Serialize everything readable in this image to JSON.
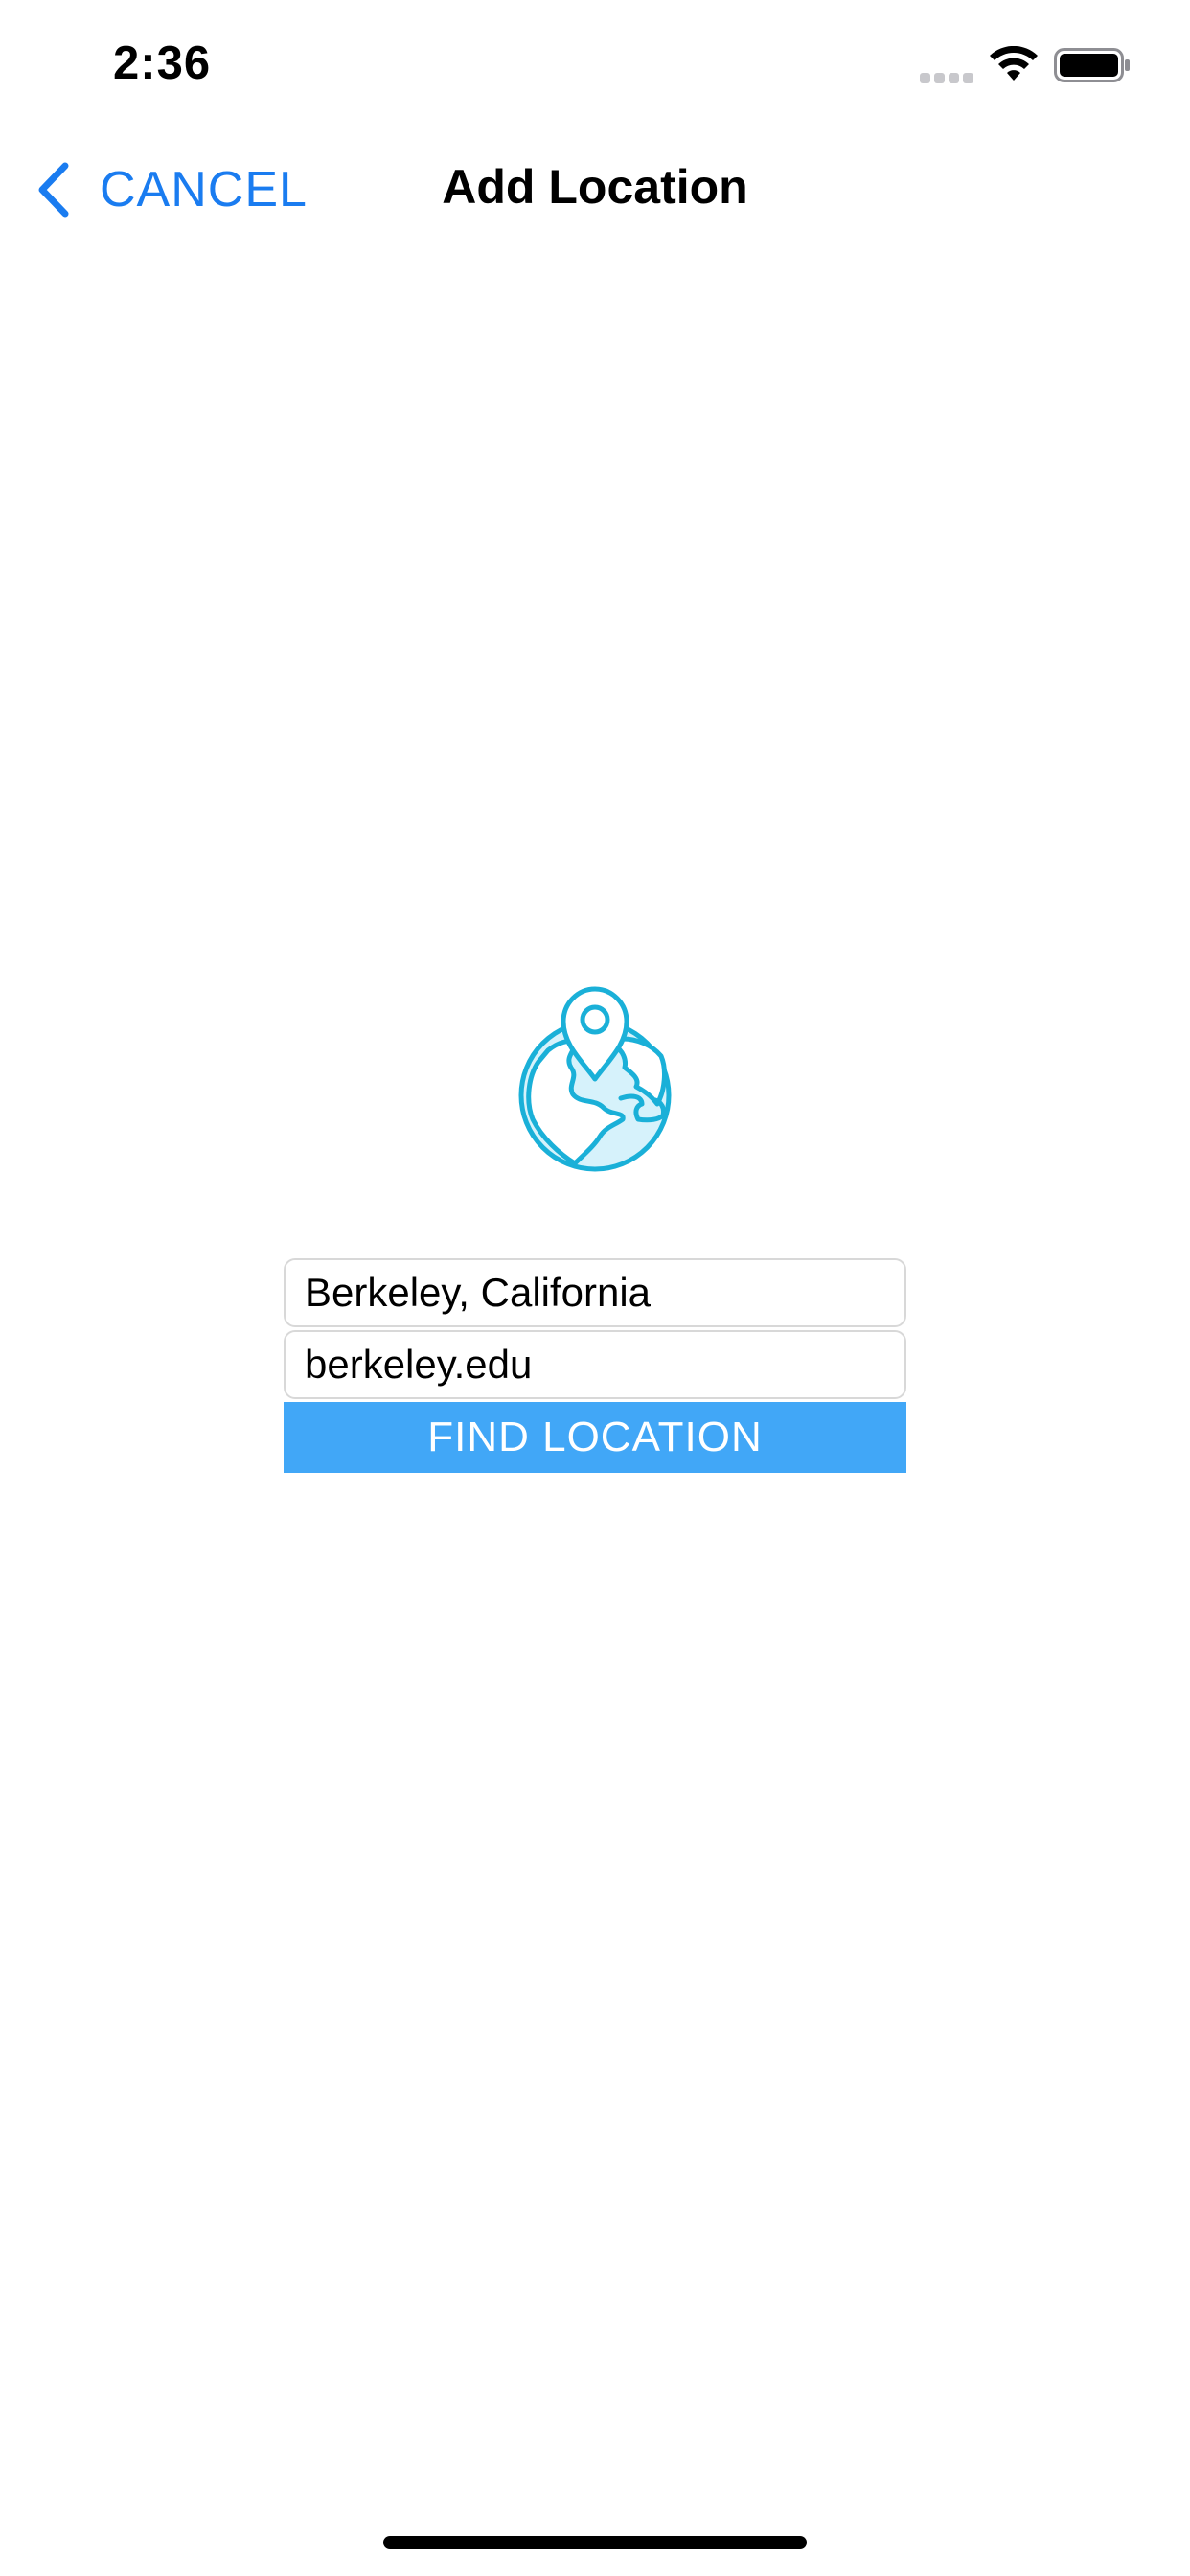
{
  "status_bar": {
    "time": "2:36"
  },
  "nav": {
    "back_label": "CANCEL",
    "title": "Add Location"
  },
  "form": {
    "location_value": "Berkeley, California",
    "website_value": "berkeley.edu",
    "find_button_label": "FIND LOCATION"
  },
  "colors": {
    "accent_blue": "#1a7cf0",
    "button_blue": "#41a7f7",
    "globe_stroke": "#1ab0d8",
    "globe_fill": "#d6f2fb"
  },
  "icons": {
    "back": "chevron-left-icon",
    "globe": "globe-location-pin-icon",
    "wifi": "wifi-icon",
    "battery": "battery-icon",
    "signal": "cellular-signal-icon"
  }
}
